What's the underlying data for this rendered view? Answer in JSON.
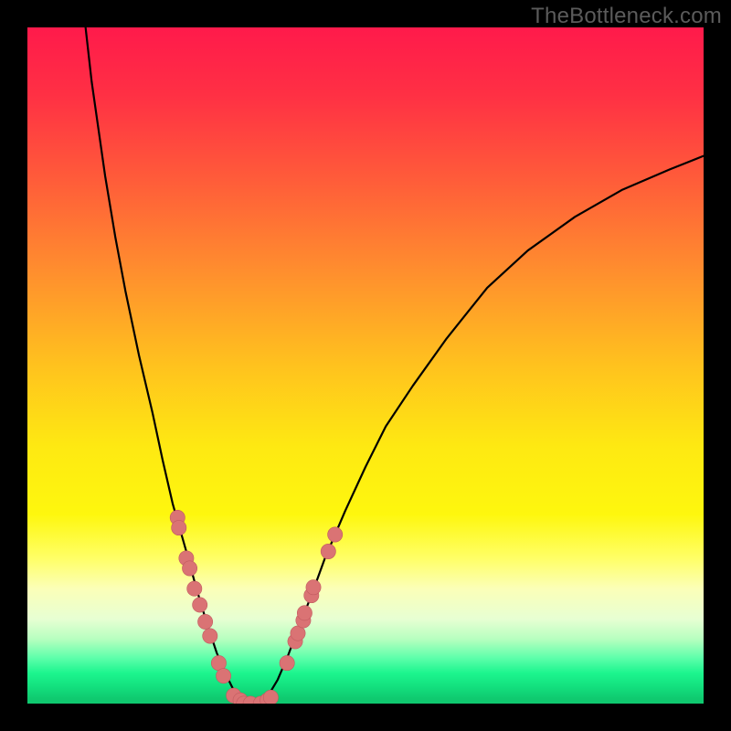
{
  "watermark": "TheBottleneck.com",
  "colors": {
    "black": "#000000",
    "curve_stroke": "#000000",
    "dot_fill": "#da7374",
    "dot_stroke": "#c25b60"
  },
  "chart_data": {
    "type": "line",
    "title": "",
    "xlabel": "",
    "ylabel": "",
    "xlim": [
      0,
      100
    ],
    "ylim": [
      0,
      100
    ],
    "gradient_stops": [
      {
        "offset": 0.0,
        "color": "#ff1a4b"
      },
      {
        "offset": 0.1,
        "color": "#ff3044"
      },
      {
        "offset": 0.22,
        "color": "#ff5a3a"
      },
      {
        "offset": 0.35,
        "color": "#ff8a2f"
      },
      {
        "offset": 0.5,
        "color": "#ffc21e"
      },
      {
        "offset": 0.62,
        "color": "#fee912"
      },
      {
        "offset": 0.72,
        "color": "#fef70e"
      },
      {
        "offset": 0.785,
        "color": "#ffff66"
      },
      {
        "offset": 0.83,
        "color": "#fbffb8"
      },
      {
        "offset": 0.875,
        "color": "#e7ffd3"
      },
      {
        "offset": 0.905,
        "color": "#b6ffbf"
      },
      {
        "offset": 0.932,
        "color": "#5fffab"
      },
      {
        "offset": 0.955,
        "color": "#1cf58e"
      },
      {
        "offset": 0.975,
        "color": "#13e07e"
      },
      {
        "offset": 0.993,
        "color": "#0fc96f"
      },
      {
        "offset": 1.0,
        "color": "#0fc96f"
      }
    ],
    "series": [
      {
        "name": "bottleneck-curve",
        "x": [
          8.6,
          9.5,
          10.5,
          11.5,
          13.0,
          14.5,
          16.5,
          18.5,
          20.0,
          21.5,
          23.5,
          25.0,
          26.5,
          28.0,
          29.5,
          31.0,
          32.5,
          34.0,
          35.5,
          37.0,
          38.5,
          40.0,
          42.0,
          44.0,
          47.0,
          50.0,
          53.0,
          57.0,
          62.0,
          68.0,
          74.0,
          81.0,
          88.0,
          95.0,
          100.0
        ],
        "y": [
          100.0,
          92.0,
          85.0,
          78.0,
          69.0,
          61.0,
          51.5,
          43.0,
          36.0,
          29.5,
          22.5,
          17.0,
          12.0,
          7.5,
          4.0,
          1.0,
          0.0,
          0.0,
          1.0,
          3.5,
          7.0,
          11.0,
          16.0,
          21.5,
          28.5,
          35.0,
          41.0,
          47.0,
          54.0,
          61.5,
          67.0,
          72.0,
          76.0,
          79.0,
          81.0
        ]
      }
    ],
    "markers": [
      {
        "x": 22.2,
        "y": 27.5
      },
      {
        "x": 22.4,
        "y": 26.0
      },
      {
        "x": 23.5,
        "y": 21.5
      },
      {
        "x": 24.0,
        "y": 20.0
      },
      {
        "x": 24.7,
        "y": 17.0
      },
      {
        "x": 25.5,
        "y": 14.6
      },
      {
        "x": 26.3,
        "y": 12.1
      },
      {
        "x": 27.0,
        "y": 10.0
      },
      {
        "x": 28.3,
        "y": 6.0
      },
      {
        "x": 29.0,
        "y": 4.1
      },
      {
        "x": 30.5,
        "y": 1.2
      },
      {
        "x": 31.5,
        "y": 0.5
      },
      {
        "x": 32.0,
        "y": 0.0
      },
      {
        "x": 33.0,
        "y": 0.0
      },
      {
        "x": 34.5,
        "y": 0.0
      },
      {
        "x": 35.5,
        "y": 0.5
      },
      {
        "x": 36.0,
        "y": 0.9
      },
      {
        "x": 38.4,
        "y": 6.0
      },
      {
        "x": 39.6,
        "y": 9.2
      },
      {
        "x": 40.0,
        "y": 10.4
      },
      {
        "x": 40.8,
        "y": 12.3
      },
      {
        "x": 41.0,
        "y": 13.4
      },
      {
        "x": 42.0,
        "y": 16.0
      },
      {
        "x": 42.3,
        "y": 17.2
      },
      {
        "x": 44.5,
        "y": 22.5
      },
      {
        "x": 45.5,
        "y": 25.0
      }
    ],
    "marker_radius_pct": 1.1,
    "valley_x": 33.0
  }
}
